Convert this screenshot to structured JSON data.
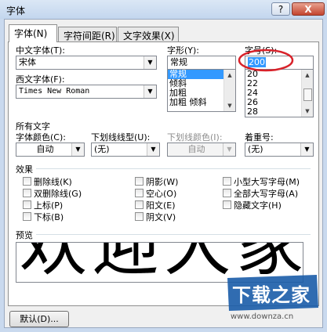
{
  "window": {
    "title": "字体",
    "help_label": "?",
    "close_label": "X"
  },
  "tabs": [
    {
      "label": "字体(N)",
      "active": true
    },
    {
      "label": "字符间距(R)",
      "active": false
    },
    {
      "label": "文字效果(X)",
      "active": false
    }
  ],
  "font": {
    "chinese_label": "中文字体(T):",
    "chinese_value": "宋体",
    "western_label": "西文字体(F):",
    "western_value": "Times New Roman",
    "style_label": "字形(Y):",
    "style_value": "常规",
    "style_options": [
      "常规",
      "倾斜",
      "加粗",
      "加粗 倾斜"
    ],
    "size_label": "字号(S):",
    "size_value": "200",
    "size_options": [
      "20",
      "22",
      "24",
      "26",
      "28"
    ]
  },
  "all_text": {
    "header": "所有文字",
    "color_label": "字体颜色(C):",
    "color_value": "自动",
    "underline_label": "下划线线型(U):",
    "underline_value": "(无)",
    "underline_color_label": "下划线颜色(I):",
    "underline_color_value": "自动",
    "emphasis_label": "着重号:",
    "emphasis_value": "(无)"
  },
  "effects": {
    "header": "效果",
    "items": [
      {
        "label": "删除线(K)",
        "checked": false
      },
      {
        "label": "双删除线(G)",
        "checked": false
      },
      {
        "label": "上标(P)",
        "checked": false
      },
      {
        "label": "下标(B)",
        "checked": false
      },
      {
        "label": "阴影(W)",
        "checked": false
      },
      {
        "label": "空心(O)",
        "checked": false
      },
      {
        "label": "阳文(E)",
        "checked": false
      },
      {
        "label": "阴文(V)",
        "checked": false
      },
      {
        "label": "小型大写字母(M)",
        "checked": false
      },
      {
        "label": "全部大写字母(A)",
        "checked": false
      },
      {
        "label": "隐藏文字(H)",
        "checked": false
      }
    ]
  },
  "preview": {
    "header": "预览",
    "sample": "欢迎大家"
  },
  "footer": {
    "default_button": "默认(D)...",
    "watermark_logo": "下载之家",
    "watermark_url": "www.downza.cn"
  },
  "colors": {
    "highlight": "#3399ff",
    "annotation": "#d8222a",
    "logo": "#1a5ca8"
  }
}
